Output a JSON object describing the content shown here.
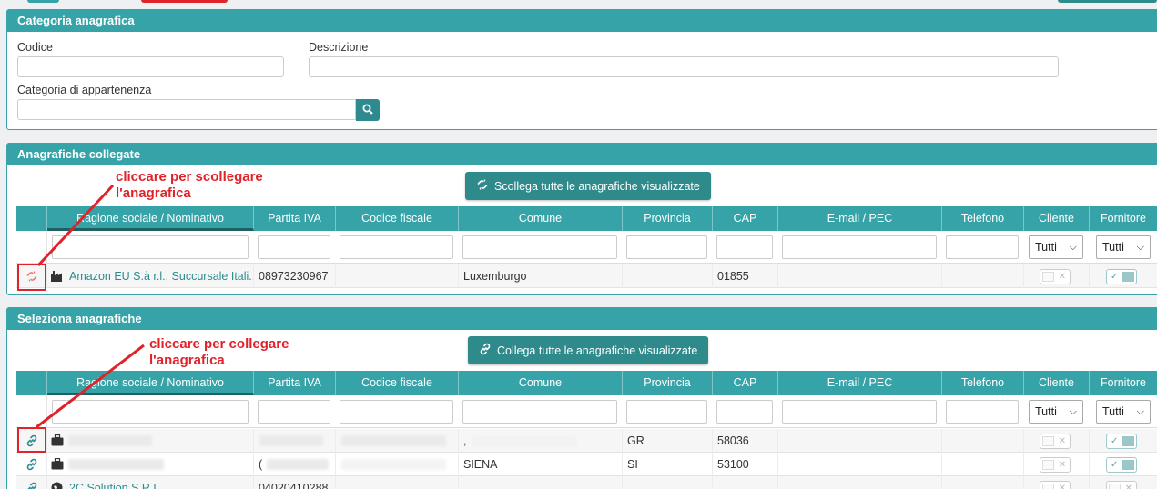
{
  "colors": {
    "accent": "#36a3a8",
    "button": "#2f8a8c",
    "annotation": "#e0232b"
  },
  "category_panel": {
    "title": "Categoria anagrafica",
    "code_label": "Codice",
    "code_value": "",
    "description_label": "Descrizione",
    "description_value": "",
    "parent_label": "Categoria di appartenenza",
    "parent_value": "",
    "search_icon": "search-icon"
  },
  "linked_panel": {
    "title": "Anagrafiche collegate",
    "bulk_button": "Scollega tutte le anagrafiche visualizzate",
    "annotation_line1": "cliccare per scollegare",
    "annotation_line2": "l'anagrafica",
    "columns": [
      "Ragione sociale / Nominativo",
      "Partita IVA",
      "Codice fiscale",
      "Comune",
      "Provincia",
      "CAP",
      "E-mail / PEC",
      "Telefono",
      "Cliente",
      "Fornitore"
    ],
    "filter_cliente": "Tutti",
    "filter_fornitore": "Tutti",
    "rows": [
      {
        "name": "Amazon EU S.à r.l., Succursale Itali...",
        "piva": "08973230967",
        "cf": "",
        "comune": "Luxemburgo",
        "provincia": "",
        "cap": "01855",
        "email": "",
        "telefono": "",
        "cliente": false,
        "fornitore": true,
        "icon": "factory-icon",
        "action_icon": "unlink-icon"
      }
    ]
  },
  "select_panel": {
    "title": "Seleziona anagrafiche",
    "bulk_button": "Collega tutte le anagrafiche visualizzate",
    "annotation_line1": "cliccare per collegare",
    "annotation_line2": "l'anagrafica",
    "columns": [
      "Ragione sociale / Nominativo",
      "Partita IVA",
      "Codice fiscale",
      "Comune",
      "Provincia",
      "CAP",
      "E-mail / PEC",
      "Telefono",
      "Cliente",
      "Fornitore"
    ],
    "filter_cliente": "Tutti",
    "filter_fornitore": "Tutti",
    "rows": [
      {
        "name": "",
        "piva": "",
        "cf": "",
        "comune": ",",
        "provincia": "GR",
        "cap": "58036",
        "email": "",
        "telefono": "",
        "cliente": false,
        "fornitore": true,
        "icon": "briefcase-icon",
        "action_icon": "link-icon"
      },
      {
        "name": "",
        "piva": "(",
        "cf": "",
        "comune": "SIENA",
        "provincia": "SI",
        "cap": "53100",
        "email": "",
        "telefono": "",
        "cliente": false,
        "fornitore": true,
        "icon": "briefcase-icon",
        "action_icon": "link-icon"
      },
      {
        "name": "2C Solution S.R.L.",
        "piva": "04020410288",
        "cf": "",
        "comune": "",
        "provincia": "",
        "cap": "",
        "email": "",
        "telefono": "",
        "cliente": false,
        "fornitore": false,
        "icon": "globe-icon",
        "action_icon": "link-icon"
      }
    ]
  }
}
